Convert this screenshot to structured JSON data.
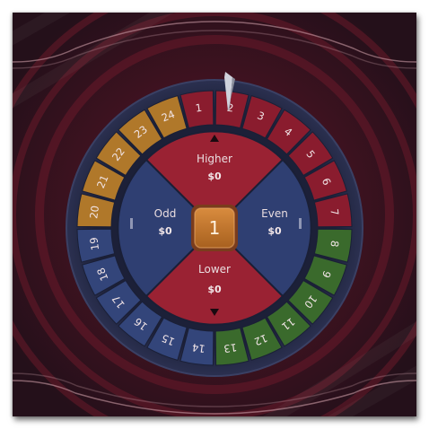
{
  "wheel": {
    "numbers": [
      "1",
      "2",
      "3",
      "4",
      "5",
      "6",
      "7",
      "8",
      "9",
      "10",
      "11",
      "12",
      "13",
      "14",
      "15",
      "16",
      "17",
      "18",
      "19",
      "20",
      "21",
      "22",
      "23",
      "24"
    ],
    "segment_groups": [
      {
        "color": "#8a1c2e",
        "numbers": [
          "1",
          "2",
          "3",
          "4",
          "5",
          "6",
          "7"
        ]
      },
      {
        "color": "#3a6a2c",
        "numbers": [
          "8",
          "9",
          "10",
          "11",
          "12",
          "13"
        ]
      },
      {
        "color": "#33457a",
        "numbers": [
          "14",
          "15",
          "16",
          "17",
          "18",
          "19"
        ]
      },
      {
        "color": "#b0782a",
        "numbers": [
          "20",
          "21",
          "22",
          "23",
          "24"
        ]
      }
    ],
    "pointer_icon": "pointer-triangle-icon"
  },
  "bets": {
    "higher": {
      "label": "Higher",
      "value": "$0",
      "color": "#9a2233",
      "icon": "arrow-up-icon"
    },
    "lower": {
      "label": "Lower",
      "value": "$0",
      "color": "#9a2233",
      "icon": "arrow-down-icon"
    },
    "odd": {
      "label": "Odd",
      "value": "$0",
      "color": "#2f3f72"
    },
    "even": {
      "label": "Even",
      "value": "$0",
      "color": "#2f3f72"
    }
  },
  "center": {
    "value": "1",
    "color": "#c47a2e"
  },
  "colors": {
    "background": "#3a1420",
    "rim": "#1f2440"
  }
}
